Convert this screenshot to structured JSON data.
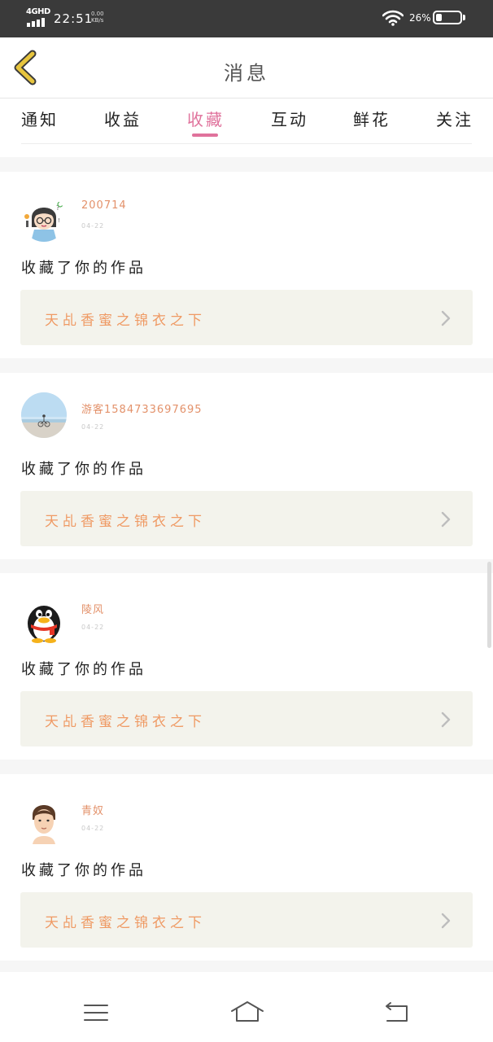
{
  "status_bar": {
    "network": "4GHD",
    "time": "22:51",
    "speed_value": "0.00",
    "speed_unit": "KB/s",
    "battery": "26%",
    "battery_level": 0.26
  },
  "header": {
    "title": "消息",
    "back_icon": "chevron-left-icon"
  },
  "tabs": [
    {
      "label": "通知",
      "active": false
    },
    {
      "label": "收益",
      "active": false
    },
    {
      "label": "收藏",
      "active": true
    },
    {
      "label": "互动",
      "active": false
    },
    {
      "label": "鲜花",
      "active": false
    },
    {
      "label": "关注",
      "active": false
    }
  ],
  "messages": [
    {
      "username": "200714",
      "date": "04-22",
      "action": "收藏了你的作品",
      "work_title": "天乩香蜜之锦衣之下"
    },
    {
      "username": "游客1584733697695",
      "date": "04-22",
      "action": "收藏了你的作品",
      "work_title": "天乩香蜜之锦衣之下"
    },
    {
      "username": "陵风",
      "date": "04-22",
      "action": "收藏了你的作品",
      "work_title": "天乩香蜜之锦衣之下"
    },
    {
      "username": "青奴",
      "date": "04-22",
      "action": "收藏了你的作品",
      "work_title": "天乩香蜜之锦衣之下"
    }
  ],
  "colors": {
    "accent": "#e0729c",
    "username": "#e3916a",
    "work_title": "#ef9a64",
    "work_bg": "#f3f3ec",
    "back_icon": "#e7c53e"
  },
  "nav_bar": {
    "menu_icon": "menu-icon",
    "home_icon": "home-icon",
    "back_icon": "back-icon"
  }
}
